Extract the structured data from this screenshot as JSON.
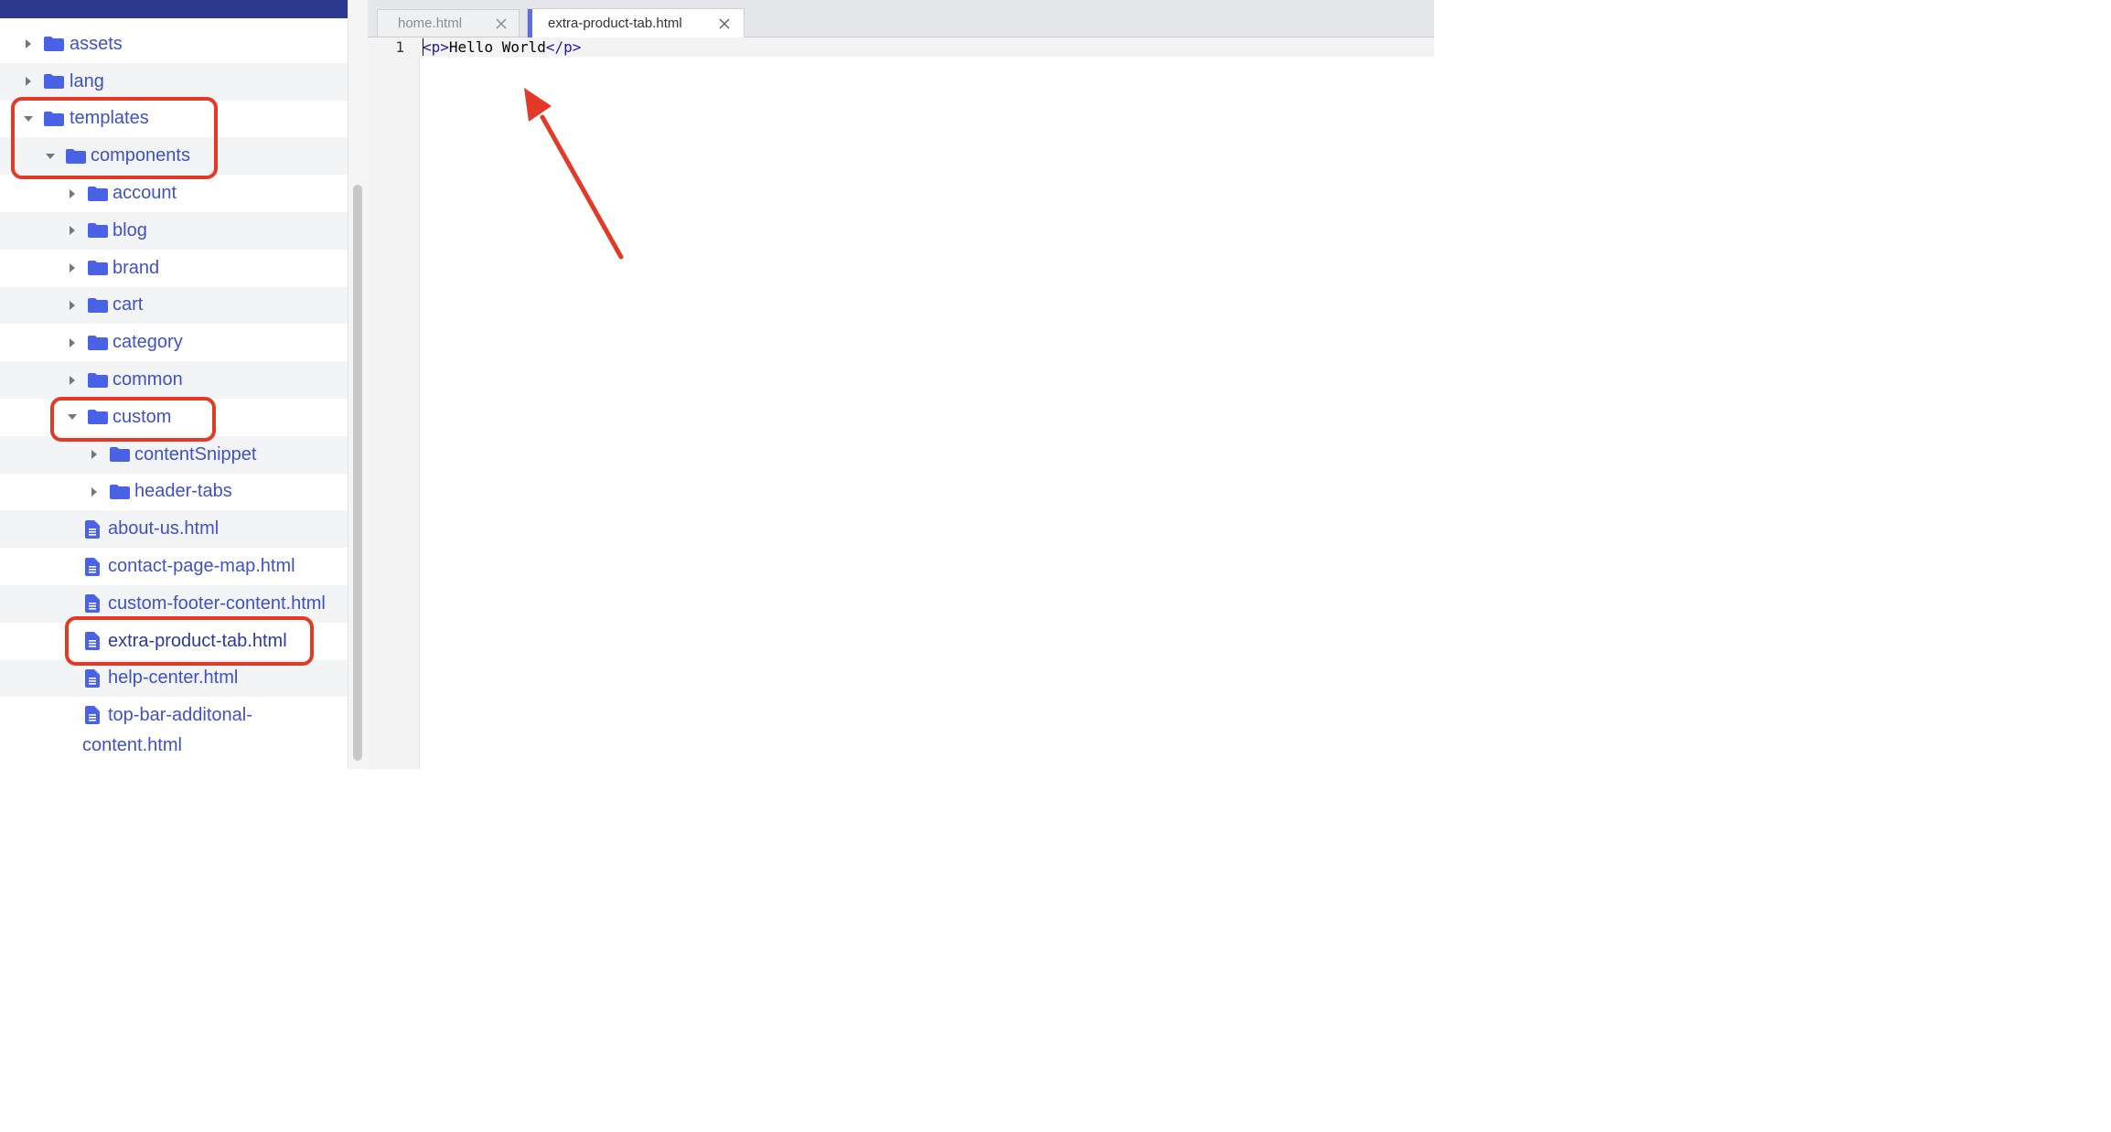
{
  "sidebar": {
    "tree": [
      {
        "label": "assets",
        "type": "folder",
        "expanded": false
      },
      {
        "label": "lang",
        "type": "folder",
        "expanded": false
      },
      {
        "label": "templates",
        "type": "folder",
        "expanded": true
      },
      {
        "label": "components",
        "type": "folder",
        "expanded": true
      },
      {
        "label": "account",
        "type": "folder",
        "expanded": false
      },
      {
        "label": "blog",
        "type": "folder",
        "expanded": false
      },
      {
        "label": "brand",
        "type": "folder",
        "expanded": false
      },
      {
        "label": "cart",
        "type": "folder",
        "expanded": false
      },
      {
        "label": "category",
        "type": "folder",
        "expanded": false
      },
      {
        "label": "common",
        "type": "folder",
        "expanded": false
      },
      {
        "label": "custom",
        "type": "folder",
        "expanded": true
      },
      {
        "label": "contentSnippet",
        "type": "folder",
        "expanded": false
      },
      {
        "label": "header-tabs",
        "type": "folder",
        "expanded": false
      },
      {
        "label": "about-us.html",
        "type": "file"
      },
      {
        "label": "contact-page-map.html",
        "type": "file"
      },
      {
        "label": "custom-footer-content.html",
        "type": "file"
      },
      {
        "label": "extra-product-tab.html",
        "type": "file",
        "active": true
      },
      {
        "label": "help-center.html",
        "type": "file"
      },
      {
        "label": "top-bar-additonal-",
        "label2": "content.html",
        "type": "file"
      }
    ]
  },
  "editor": {
    "tabs": [
      {
        "label": "home.html",
        "active": false
      },
      {
        "label": "extra-product-tab.html",
        "active": true
      }
    ],
    "line_number": "1",
    "code": {
      "open_tag": "<p>",
      "text": "Hello World",
      "close_tag": "</p>"
    }
  },
  "colors": {
    "accent": "#5b6ee8",
    "folder": "#4a63e6",
    "annotation": "#e23a27",
    "header": "#2b3a8c"
  }
}
